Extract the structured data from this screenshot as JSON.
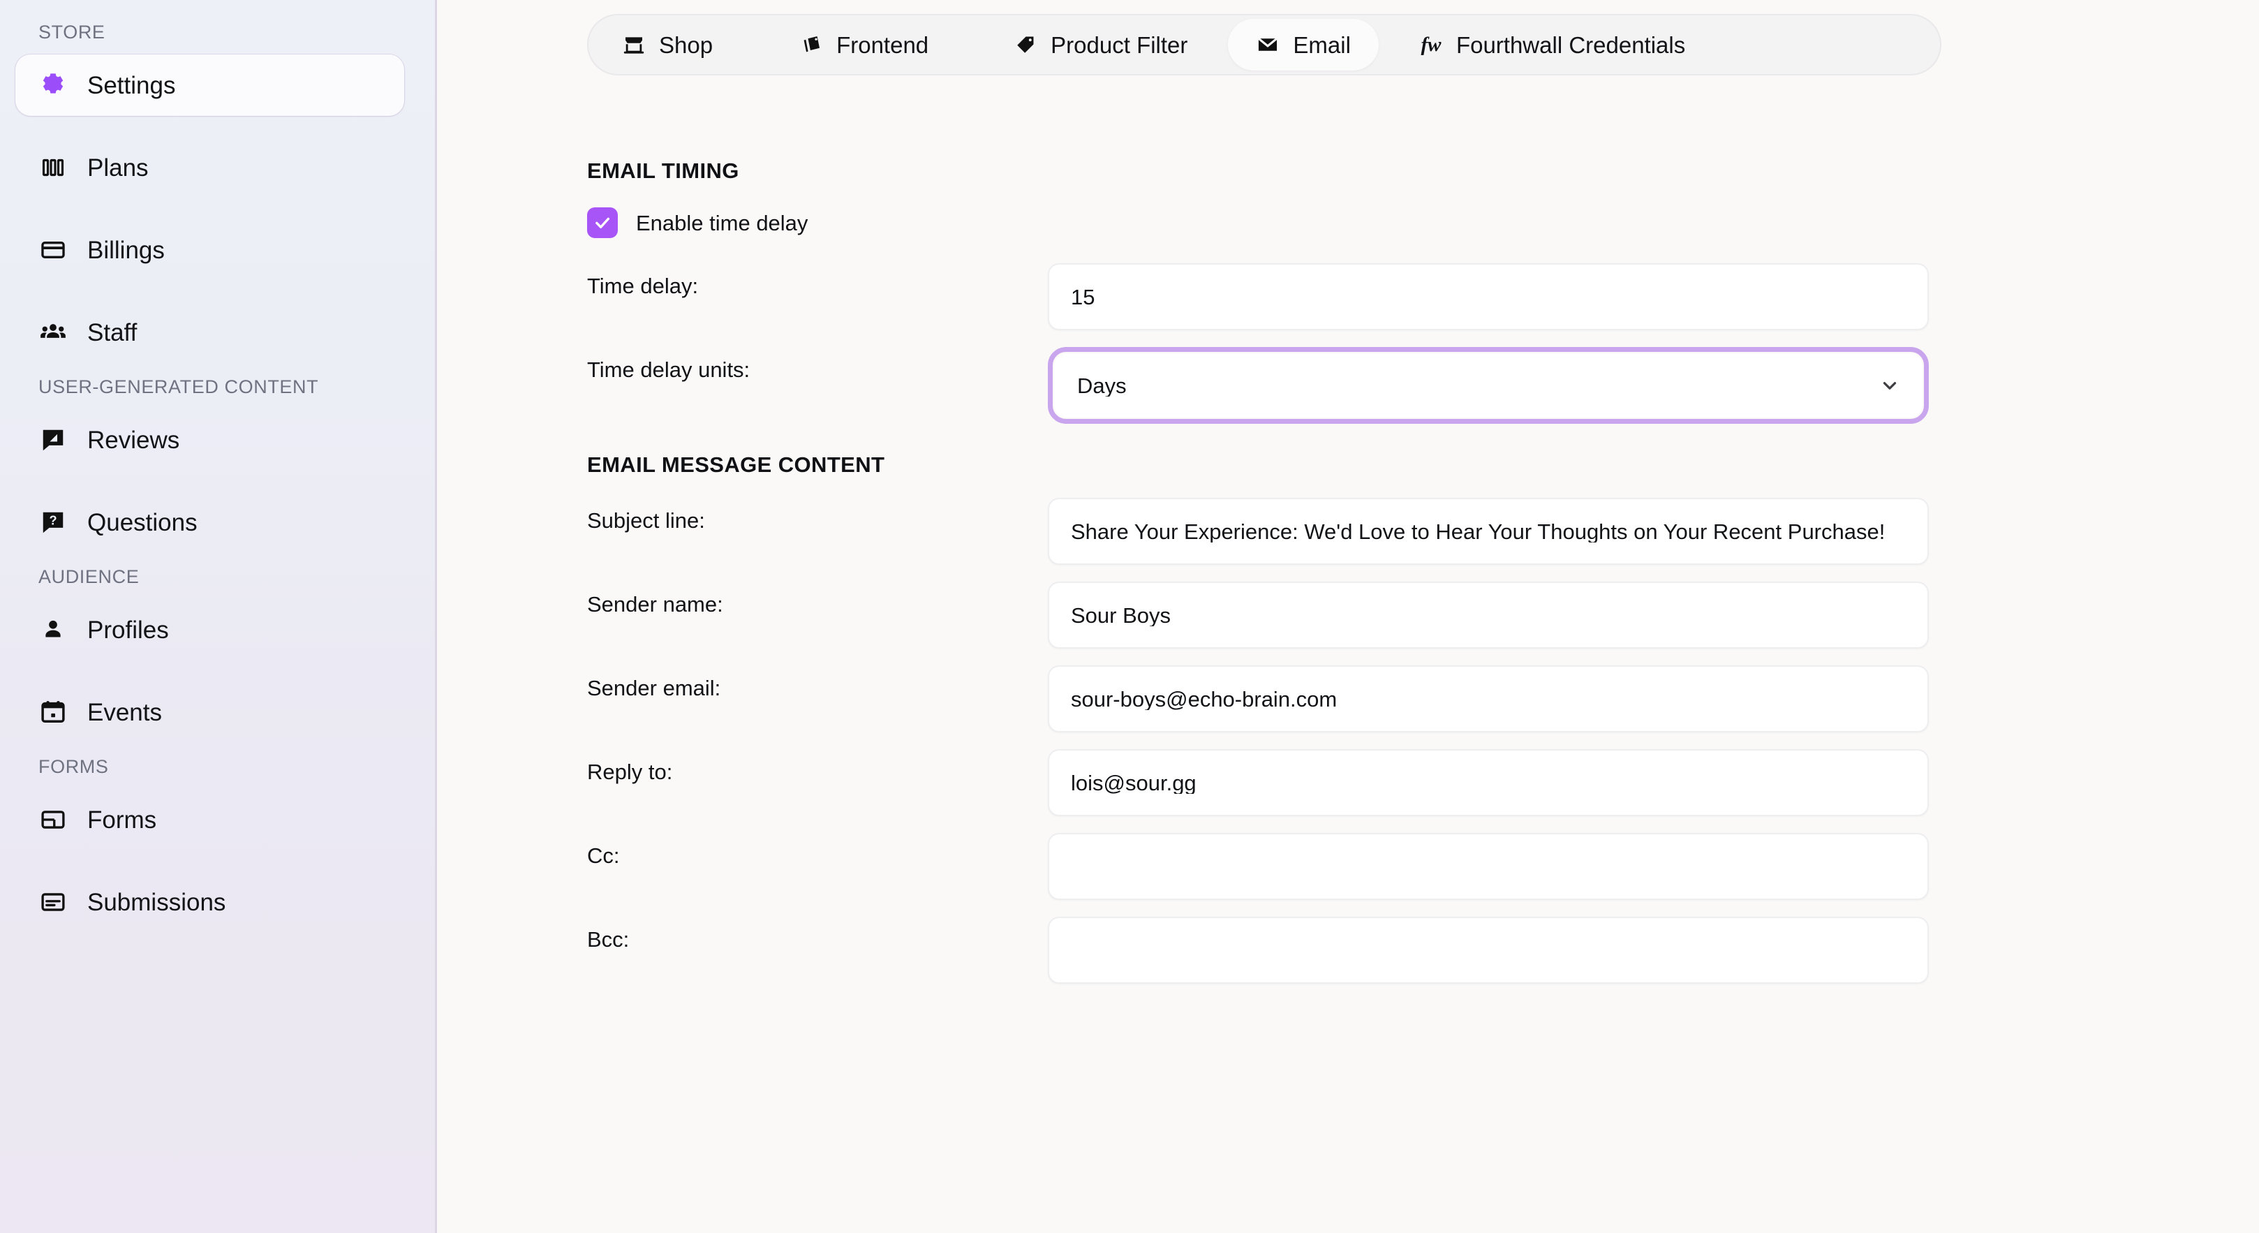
{
  "sidebar": {
    "sections": [
      {
        "label": "STORE",
        "items": [
          {
            "label": "Settings",
            "icon": "gear-icon",
            "active": true
          },
          {
            "label": "Plans",
            "icon": "plans-bars-icon",
            "active": false
          },
          {
            "label": "Billings",
            "icon": "credit-card-icon",
            "active": false
          },
          {
            "label": "Staff",
            "icon": "people-group-icon",
            "active": false
          }
        ]
      },
      {
        "label": "USER-GENERATED CONTENT",
        "items": [
          {
            "label": "Reviews",
            "icon": "review-speech-bubble-icon",
            "active": false
          },
          {
            "label": "Questions",
            "icon": "question-speech-bubble-icon",
            "active": false
          }
        ]
      },
      {
        "label": "AUDIENCE",
        "items": [
          {
            "label": "Profiles",
            "icon": "person-icon",
            "active": false
          },
          {
            "label": "Events",
            "icon": "calendar-icon",
            "active": false
          }
        ]
      },
      {
        "label": "FORMS",
        "items": [
          {
            "label": "Forms",
            "icon": "form-layout-icon",
            "active": false
          },
          {
            "label": "Submissions",
            "icon": "submission-lines-icon",
            "active": false
          }
        ]
      }
    ]
  },
  "tabs": [
    {
      "label": "Shop",
      "icon": "storefront-icon",
      "active": false
    },
    {
      "label": "Frontend",
      "icon": "layers-icon",
      "active": false
    },
    {
      "label": "Product Filter",
      "icon": "tag-icon",
      "active": false
    },
    {
      "label": "Email",
      "icon": "envelope-icon",
      "active": true
    },
    {
      "label": "Fourthwall Credentials",
      "icon": "fw-wordmark-icon",
      "active": false
    }
  ],
  "email_timing": {
    "section_title": "EMAIL TIMING",
    "enable_time_delay_label": "Enable time delay",
    "enable_time_delay_checked": true,
    "time_delay_label": "Time delay:",
    "time_delay_value": "15",
    "time_delay_units_label": "Time delay units:",
    "time_delay_units_value": "Days"
  },
  "email_message_content": {
    "section_title": "EMAIL MESSAGE CONTENT",
    "subject_line_label": "Subject line:",
    "subject_line_value": "Share Your Experience: We'd Love to Hear Your Thoughts on Your Recent Purchase!",
    "sender_name_label": "Sender name:",
    "sender_name_value": "Sour Boys",
    "sender_email_label": "Sender email:",
    "sender_email_value": "sour-boys@echo-brain.com",
    "reply_to_label": "Reply to:",
    "reply_to_value": "lois@sour.gg",
    "cc_label": "Cc:",
    "cc_value": "",
    "bcc_label": "Bcc:",
    "bcc_value": ""
  },
  "colors": {
    "accent_purple": "#a855f7",
    "focus_ring": "#c9a5ee",
    "sidebar_gradient_top": "#eef0f7",
    "sidebar_gradient_bottom": "#ece7f2",
    "main_background": "#faf9f7"
  }
}
